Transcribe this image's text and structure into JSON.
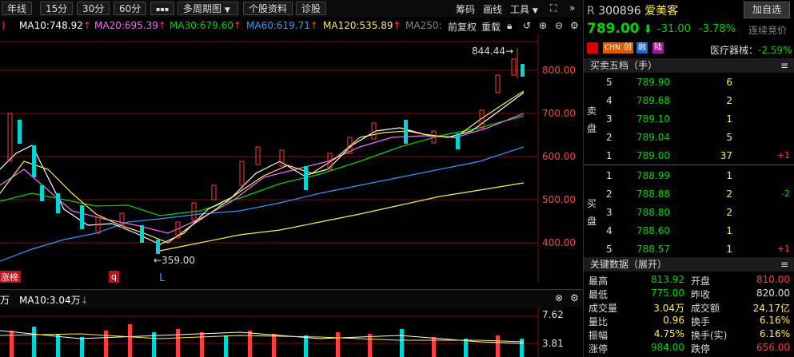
{
  "toolbar": {
    "periods": [
      "年线",
      "15分",
      "30分",
      "60分"
    ],
    "more_label": "▪▪▪",
    "multi_period": "多周期图",
    "profile": "个股资料",
    "diagnose": "诊股",
    "chip": "筹码",
    "draw": "画线",
    "tools": "工具"
  },
  "ma_line": {
    "ma10": "MA10:748.92",
    "ma20": "MA20:695.39",
    "ma30": "MA30:679.60",
    "ma60": "MA60:619.71",
    "ma120": "MA120:535.89",
    "ma250": "MA250:",
    "fq": "前复权",
    "redo": "重载"
  },
  "colors": {
    "ma10": "#ffffff",
    "ma20": "#ff66ff",
    "ma30": "#00d600",
    "ma60": "#3399ff",
    "ma120": "#ffee55",
    "ma250": "#888888",
    "up": "#ff3b3b",
    "down": "#00d6d6"
  },
  "chart": {
    "y_ticks": [
      "800.00",
      "700.00",
      "600.00",
      "500.00",
      "400.00"
    ],
    "high_label": "844.44→",
    "low_label": "←359.00",
    "tag_limit": "涨榜",
    "tag_q": "q",
    "tag_l": "L"
  },
  "volume": {
    "prefix": "万",
    "ma10": "MA10:3.04万",
    "ticks": [
      "7.62",
      "3.81"
    ]
  },
  "quote": {
    "prefix": "R",
    "code": "300896",
    "name": "爱美客",
    "add_button": "加自选",
    "price": "789.00",
    "change": "-31.00",
    "change_pct": "-3.78%",
    "auction": "连续竞价",
    "badges": [
      "CHN",
      "创",
      "融",
      "陆"
    ],
    "industry": "医疗器械：",
    "industry_pct": "-2.59%"
  },
  "order_book": {
    "title": "买卖五档（手）",
    "sell_label": "卖盘",
    "buy_label": "买盘",
    "asks": [
      {
        "level": "5",
        "price": "789.90",
        "vol": "6",
        "delta": ""
      },
      {
        "level": "4",
        "price": "789.68",
        "vol": "2",
        "delta": ""
      },
      {
        "level": "3",
        "price": "789.10",
        "vol": "1",
        "delta": ""
      },
      {
        "level": "2",
        "price": "789.04",
        "vol": "5",
        "delta": ""
      },
      {
        "level": "1",
        "price": "789.00",
        "vol": "37",
        "delta": "+1"
      }
    ],
    "bids": [
      {
        "level": "1",
        "price": "788.99",
        "vol": "1",
        "delta": ""
      },
      {
        "level": "2",
        "price": "788.88",
        "vol": "2",
        "delta": "-2"
      },
      {
        "level": "3",
        "price": "788.80",
        "vol": "2",
        "delta": ""
      },
      {
        "level": "4",
        "price": "788.60",
        "vol": "1",
        "delta": ""
      },
      {
        "level": "5",
        "price": "788.57",
        "vol": "1",
        "delta": "+1"
      }
    ]
  },
  "key_data": {
    "title": "关键数据（展开）",
    "rows": [
      {
        "l1": "最高",
        "v1": "813.92",
        "l2": "开盘",
        "v2": "810.00"
      },
      {
        "l1": "最低",
        "v1": "775.00",
        "l2": "昨收",
        "v2": "820.00"
      },
      {
        "l1": "成交量",
        "v1": "3.04万",
        "l2": "成交额",
        "v2": "24.17亿"
      },
      {
        "l1": "量比",
        "v1": "0.96",
        "l2": "换手",
        "v2": "6.16%"
      },
      {
        "l1": "振幅",
        "v1": "4.75%",
        "l2": "换手(实)",
        "v2": "6.16%"
      },
      {
        "l1": "涨停",
        "v1": "984.00",
        "l2": "跌停",
        "v2": "656.00"
      }
    ]
  }
}
